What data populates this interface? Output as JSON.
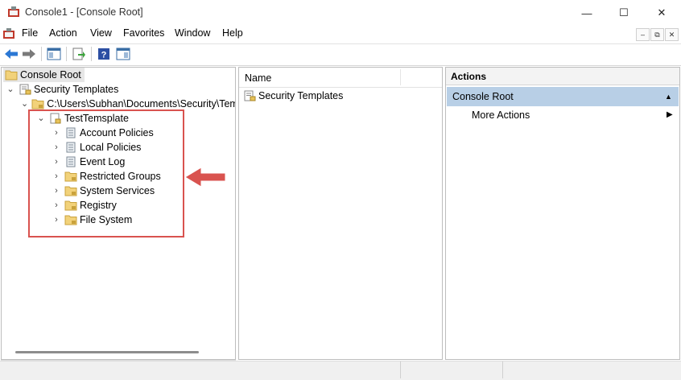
{
  "window": {
    "title": "Console1 - [Console Root]",
    "controls": {
      "minimize": "—",
      "maximize": "☐",
      "close": "✕"
    }
  },
  "menu": {
    "items": [
      "File",
      "Action",
      "View",
      "Favorites",
      "Window",
      "Help"
    ],
    "mdi": {
      "minimize": "–",
      "restore": "⧉",
      "close": "✕"
    }
  },
  "toolbar": {
    "icons": [
      "back-arrow-icon",
      "forward-arrow-icon",
      "show-hide-tree-icon",
      "export-list-icon",
      "help-icon",
      "show-hide-action-pane-icon"
    ]
  },
  "tree": {
    "root": "Console Root",
    "security_templates": "Security Templates",
    "path": "C:\\Users\\Subhan\\Documents\\Security\\Templates",
    "template": "TestTemsplate",
    "children": [
      "Account Policies",
      "Local Policies",
      "Event Log",
      "Restricted Groups",
      "System Services",
      "Registry",
      "File System"
    ]
  },
  "list": {
    "column_name": "Name",
    "items": [
      "Security Templates"
    ]
  },
  "actions": {
    "header": "Actions",
    "section": "Console Root",
    "items": [
      "More Actions"
    ]
  },
  "colors": {
    "accent_blue": "#2c78d4",
    "callout_red": "#d9534f",
    "actions_section_bg": "#b8cfe6",
    "folder_yellow": "#e8c35a"
  }
}
